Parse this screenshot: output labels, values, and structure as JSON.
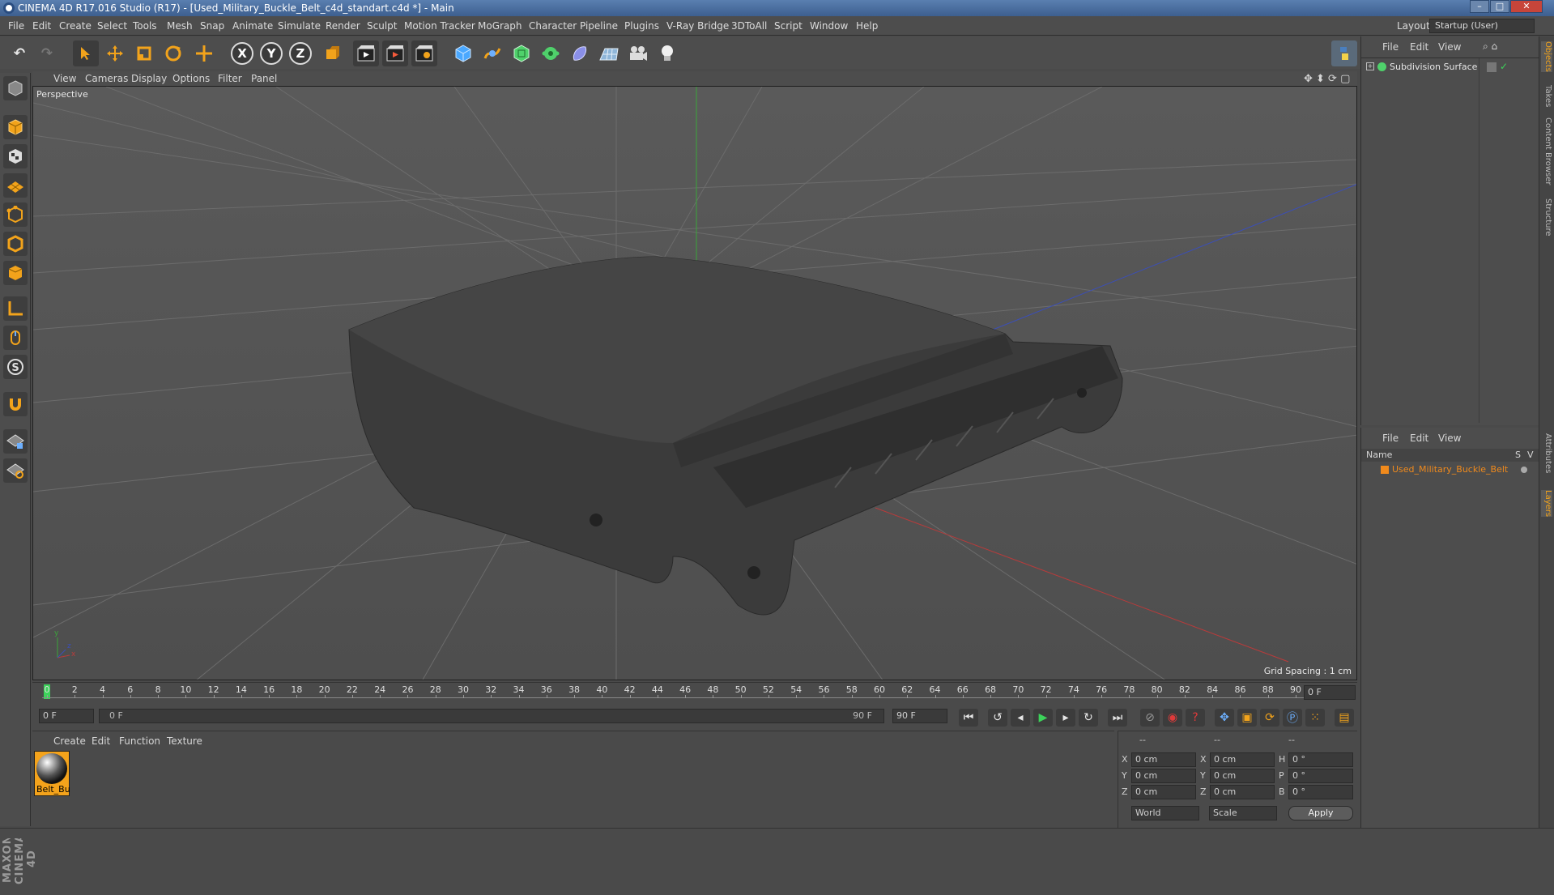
{
  "window": {
    "title": "CINEMA 4D R17.016 Studio (R17) - [Used_Military_Buckle_Belt_c4d_standart.c4d *] - Main",
    "minimize": "–",
    "maximize": "□",
    "close": "✕"
  },
  "menubar": {
    "items": [
      "File",
      "Edit",
      "Create",
      "Select",
      "Tools",
      "Mesh",
      "Snap",
      "Animate",
      "Simulate",
      "Render",
      "Sculpt",
      "Motion Tracker",
      "MoGraph",
      "Character",
      "Pipeline",
      "Plugins",
      "V-Ray Bridge",
      "3DToAll",
      "Script",
      "Window",
      "Help"
    ],
    "layout_label": "Layout:",
    "layout_value": "Startup (User)"
  },
  "toolbar": {
    "undo": "↶",
    "redo": "↷",
    "tools": [
      "select-arrow",
      "move",
      "scale",
      "rotate",
      "live-select"
    ],
    "axes": [
      "X",
      "Y",
      "Z"
    ]
  },
  "viewport": {
    "menus": [
      "View",
      "Cameras",
      "Display",
      "Options",
      "Filter",
      "Panel"
    ],
    "label": "Perspective",
    "grid_spacing": "Grid Spacing : 1 cm",
    "axis_y": "y",
    "axis_x": "x",
    "axis_z": "z"
  },
  "timeline": {
    "ticks": [
      "0",
      "2",
      "4",
      "6",
      "8",
      "10",
      "12",
      "14",
      "16",
      "18",
      "20",
      "22",
      "24",
      "26",
      "28",
      "30",
      "32",
      "34",
      "36",
      "38",
      "40",
      "42",
      "44",
      "46",
      "48",
      "50",
      "52",
      "54",
      "56",
      "58",
      "60",
      "62",
      "64",
      "66",
      "68",
      "70",
      "72",
      "74",
      "76",
      "78",
      "80",
      "82",
      "84",
      "86",
      "88",
      "90"
    ],
    "end_field": "0 F"
  },
  "playback": {
    "current_frame": "0 F",
    "range_start": "0 F",
    "range_end": "90 F",
    "end_frame": "90 F"
  },
  "materials": {
    "menus": [
      "Create",
      "Edit",
      "Function",
      "Texture"
    ],
    "items": [
      {
        "name": "Belt_Bu"
      }
    ]
  },
  "coordinates": {
    "header": [
      "--",
      "--",
      "--"
    ],
    "rows": [
      {
        "a": "X",
        "av": "0 cm",
        "b": "X",
        "bv": "0 cm",
        "c": "H",
        "cv": "0 °"
      },
      {
        "a": "Y",
        "av": "0 cm",
        "b": "Y",
        "bv": "0 cm",
        "c": "P",
        "cv": "0 °"
      },
      {
        "a": "Z",
        "av": "0 cm",
        "b": "Z",
        "bv": "0 cm",
        "c": "B",
        "cv": "0 °"
      }
    ],
    "world": "World",
    "scale": "Scale",
    "apply": "Apply"
  },
  "objects": {
    "menus": [
      "File",
      "Edit",
      "View"
    ],
    "items": [
      {
        "name": "Subdivision Surface"
      }
    ]
  },
  "layers": {
    "menus": [
      "File",
      "Edit",
      "View"
    ],
    "col_name": "Name",
    "col_s": "S",
    "col_v": "V",
    "items": [
      {
        "name": "Used_Military_Buckle_Belt"
      }
    ]
  },
  "side_tabs": [
    "Objects",
    "Takes",
    "Content Browser",
    "Structure",
    "Attributes",
    "Layers"
  ],
  "logo": "MAXON CINEMA 4D",
  "colors": {
    "accent": "#f2a31b",
    "title_blue": "#3d5f8f",
    "layer_orange": "#f08a1c"
  }
}
